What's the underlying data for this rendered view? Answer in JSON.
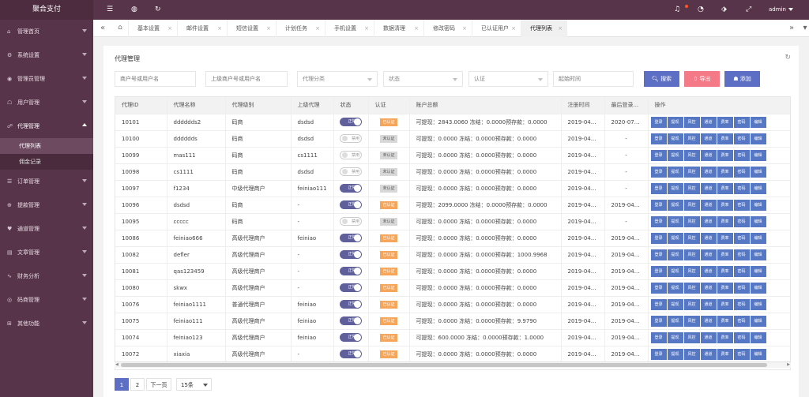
{
  "app": {
    "title": "聚合支付"
  },
  "sidebar": {
    "items": [
      {
        "label": "管理首页",
        "icon": "home-icon",
        "glyph": "⌂"
      },
      {
        "label": "系统设置",
        "icon": "gear-icon",
        "glyph": "⚙"
      },
      {
        "label": "管理员管理",
        "icon": "admin-icon",
        "glyph": "◉"
      },
      {
        "label": "用户管理",
        "icon": "user-icon",
        "glyph": "☖"
      },
      {
        "label": "代理管理",
        "icon": "agent-icon",
        "glyph": "☍"
      },
      {
        "label": "订单管理",
        "icon": "order-icon",
        "glyph": "☰"
      },
      {
        "label": "提款管理",
        "icon": "withdraw-icon",
        "glyph": "⊕"
      },
      {
        "label": "通道管理",
        "icon": "channel-icon",
        "glyph": "♥"
      },
      {
        "label": "文章管理",
        "icon": "article-icon",
        "glyph": "▤"
      },
      {
        "label": "财务分析",
        "icon": "finance-icon",
        "glyph": "∿"
      },
      {
        "label": "码商管理",
        "icon": "merchant-icon",
        "glyph": "◎"
      },
      {
        "label": "其他功能",
        "icon": "other-icon",
        "glyph": "⊞"
      }
    ],
    "sub_items": [
      {
        "label": "代理列表",
        "active": true
      },
      {
        "label": "佣金记录",
        "active": false
      }
    ]
  },
  "topbar": {
    "icons": [
      {
        "name": "menu-toggle-icon",
        "glyph": "☰"
      },
      {
        "name": "globe-icon",
        "glyph": "◍"
      },
      {
        "name": "refresh-icon",
        "glyph": "↻"
      },
      {
        "name": "bell-icon",
        "glyph": "♫"
      },
      {
        "name": "dashboard-icon",
        "glyph": "◔"
      },
      {
        "name": "tag-icon",
        "glyph": "⬗"
      },
      {
        "name": "fullscreen-icon",
        "glyph": "⤢"
      }
    ],
    "user": "admin"
  },
  "tabs": [
    {
      "label": "基本设置",
      "active": false
    },
    {
      "label": "邮件设置",
      "active": false
    },
    {
      "label": "短信设置",
      "active": false
    },
    {
      "label": "计划任务",
      "active": false
    },
    {
      "label": "手机设置",
      "active": false
    },
    {
      "label": "数据清理",
      "active": false
    },
    {
      "label": "修改密码",
      "active": false
    },
    {
      "label": "已认证用户",
      "active": false
    },
    {
      "label": "代理列表",
      "active": true
    }
  ],
  "panel": {
    "title": "代理管理",
    "filters": {
      "account_placeholder": "商户号或用户名",
      "parent_placeholder": "上级商户号或用户名",
      "category": "代理分类",
      "status": "状态",
      "cert": "认证",
      "start_time_placeholder": "起始时间"
    },
    "buttons": {
      "search": "搜索",
      "export": "导出",
      "add": "添加"
    }
  },
  "table": {
    "columns": [
      "代理ID",
      "代理名称",
      "代理级别",
      "上级代理",
      "状态",
      "认证",
      "账户总额",
      "注册时间",
      "最后登录...",
      "操作"
    ],
    "actions": [
      "登录",
      "提现",
      "风控",
      "通道",
      "费率",
      "密码",
      "编辑"
    ],
    "rows": [
      {
        "id": "10101",
        "name": "dddddds2",
        "level": "码商",
        "parent": "dsdsd",
        "status": "正常",
        "status_on": true,
        "cert": "已认证",
        "cert_ok": true,
        "balance": "可提现：2843.0060 冻结：0.0000预存款：0.0000",
        "reg": "2019-04...",
        "last": "2020-07..."
      },
      {
        "id": "10100",
        "name": "dddddds",
        "level": "码商",
        "parent": "dsdsd",
        "status": "禁用",
        "status_on": false,
        "cert": "未认证",
        "cert_ok": false,
        "balance": "可提现：0.0000 冻结：0.0000预存款：0.0000",
        "reg": "2019-04...",
        "last": "-"
      },
      {
        "id": "10099",
        "name": "mas111",
        "level": "码商",
        "parent": "cs1111",
        "status": "禁用",
        "status_on": false,
        "cert": "未认证",
        "cert_ok": false,
        "balance": "可提现：0.0000 冻结：0.0000预存款：0.0000",
        "reg": "2019-04...",
        "last": "-"
      },
      {
        "id": "10098",
        "name": "cs1111",
        "level": "码商",
        "parent": "dsdsd",
        "status": "禁用",
        "status_on": false,
        "cert": "未认证",
        "cert_ok": false,
        "balance": "可提现：0.0000 冻结：0.0000预存款：0.0000",
        "reg": "2019-04...",
        "last": "-"
      },
      {
        "id": "10097",
        "name": "f1234",
        "level": "中级代理商户",
        "parent": "feiniao111",
        "status": "正常",
        "status_on": true,
        "cert": "未认证",
        "cert_ok": false,
        "balance": "可提现：0.0000 冻结：0.0000预存款：0.0000",
        "reg": "2019-04...",
        "last": "-"
      },
      {
        "id": "10096",
        "name": "dsdsd",
        "level": "码商",
        "parent": "-",
        "status": "正常",
        "status_on": true,
        "cert": "已认证",
        "cert_ok": true,
        "balance": "可提现：2099.0000 冻结：0.0000预存款：0.0000",
        "reg": "2019-04...",
        "last": "2019-04..."
      },
      {
        "id": "10095",
        "name": "ccccc",
        "level": "码商",
        "parent": "-",
        "status": "禁用",
        "status_on": false,
        "cert": "未认证",
        "cert_ok": false,
        "balance": "可提现：0.0000 冻结：0.0000预存款：0.0000",
        "reg": "2019-04...",
        "last": "-"
      },
      {
        "id": "10086",
        "name": "feiniao666",
        "level": "高级代理商户",
        "parent": "feiniao",
        "status": "正常",
        "status_on": true,
        "cert": "已认证",
        "cert_ok": true,
        "balance": "可提现：0.0000 冻结：0.0000预存款：0.0000",
        "reg": "2019-04...",
        "last": "2019-04..."
      },
      {
        "id": "10082",
        "name": "defler",
        "level": "高级代理商户",
        "parent": "-",
        "status": "正常",
        "status_on": true,
        "cert": "已认证",
        "cert_ok": true,
        "balance": "可提现：0.0000 冻结：0.0000预存款：1000.9968",
        "reg": "2019-04...",
        "last": "2019-04..."
      },
      {
        "id": "10081",
        "name": "qas123459",
        "level": "高级代理商户",
        "parent": "-",
        "status": "正常",
        "status_on": true,
        "cert": "已认证",
        "cert_ok": true,
        "balance": "可提现：0.0000 冻结：0.0000预存款：0.0000",
        "reg": "2019-04...",
        "last": "2019-04..."
      },
      {
        "id": "10080",
        "name": "skwx",
        "level": "高级代理商户",
        "parent": "-",
        "status": "正常",
        "status_on": true,
        "cert": "已认证",
        "cert_ok": true,
        "balance": "可提现：0.0000 冻结：0.0000预存款：0.0000",
        "reg": "2019-04...",
        "last": "2019-04..."
      },
      {
        "id": "10076",
        "name": "feiniao1111",
        "level": "普通代理商户",
        "parent": "feiniao",
        "status": "正常",
        "status_on": true,
        "cert": "已认证",
        "cert_ok": true,
        "balance": "可提现：0.0000 冻结：0.0000预存款：0.0000",
        "reg": "2019-04...",
        "last": "2019-04..."
      },
      {
        "id": "10075",
        "name": "feiniao111",
        "level": "高级代理商户",
        "parent": "feiniao",
        "status": "正常",
        "status_on": true,
        "cert": "已认证",
        "cert_ok": true,
        "balance": "可提现：0.0000 冻结：0.0000预存款：9.9790",
        "reg": "2019-04...",
        "last": "2019-04..."
      },
      {
        "id": "10074",
        "name": "feiniao123",
        "level": "高级代理商户",
        "parent": "feiniao",
        "status": "正常",
        "status_on": true,
        "cert": "已认证",
        "cert_ok": true,
        "balance": "可提现：600.0000 冻结：0.0000预存款：1.0000",
        "reg": "2019-04...",
        "last": "2019-04..."
      },
      {
        "id": "10072",
        "name": "xiaxia",
        "level": "高级代理商户",
        "parent": "-",
        "status": "正常",
        "status_on": true,
        "cert": "已认证",
        "cert_ok": true,
        "balance": "可提现：0.0000 冻结：0.0000预存款：0.0000",
        "reg": "2019-04...",
        "last": "2019-04..."
      }
    ]
  },
  "pagination": {
    "pages": [
      "1",
      "2"
    ],
    "next": "下一页",
    "page_size": "15条"
  },
  "colors": {
    "sidebar": "#58344a",
    "primary": "#5d6fc4",
    "action": "#5577c4",
    "export": "#f47a88",
    "switch_on": "#5f5f9b",
    "cert_ok": "#f6a65a"
  }
}
